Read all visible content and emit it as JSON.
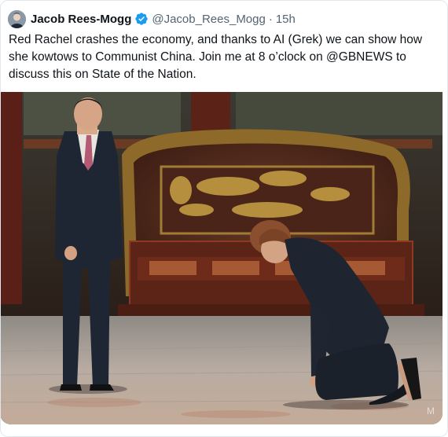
{
  "tweet": {
    "author_name": "Jacob Rees-Mogg",
    "handle": "@Jacob_Rees_Mogg",
    "separator": "·",
    "time": "15h",
    "text": "Red Rachel crashes the economy, and thanks to AI (Grek) we can show how she kowtows to Communist China. Join me at 8 o’clock on @GBNEWS to discuss this on State of the Nation."
  },
  "media": {
    "watermark": "M"
  },
  "icons": {
    "verified": "verified-badge-icon"
  },
  "colors": {
    "verified_blue": "#1d9bf0",
    "text": "#0f1419",
    "muted": "#536471"
  }
}
